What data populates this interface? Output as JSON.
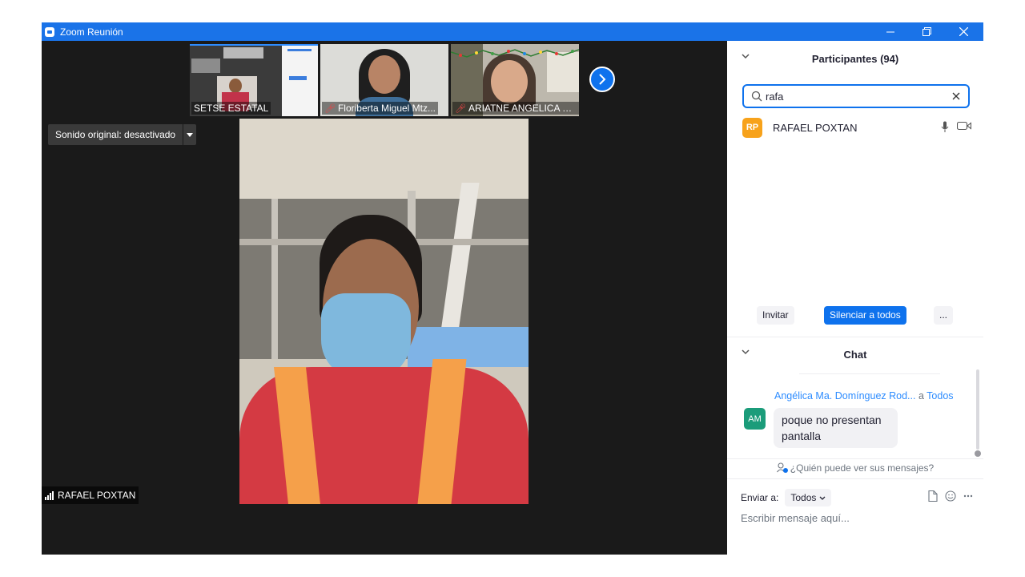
{
  "window": {
    "title": "Zoom Reunión",
    "controls": {
      "minimize": "—",
      "restore": "❐",
      "close": "✕"
    }
  },
  "gallery": {
    "thumbnails": [
      {
        "name": "SETSE ESTATAL",
        "muted": false
      },
      {
        "name": "Floriberta Miguel Mtz...",
        "muted": true
      },
      {
        "name": "ARIATNE ANGELICA R...",
        "muted": true
      }
    ],
    "next_icon": "chevron-right-icon"
  },
  "sound_button": {
    "label": "Sonido original: desactivado"
  },
  "active_speaker": {
    "name": "RAFAEL POXTAN"
  },
  "participants": {
    "header": "Participantes (94)",
    "search_value": "rafa",
    "list": [
      {
        "initials": "RP",
        "name": "RAFAEL POXTAN",
        "avatar_color": "#f7a21b"
      }
    ],
    "buttons": {
      "invite": "Invitar",
      "mute_all": "Silenciar a todos",
      "more": "..."
    }
  },
  "chat": {
    "header": "Chat",
    "messages": [
      {
        "initials": "AM",
        "avatar_color": "#1b9c7a",
        "sender": "Angélica Ma. Domínguez Rod...",
        "to_prefix": "a",
        "to": "Todos",
        "text": "poque no presentan pantalla"
      }
    ],
    "who_can_see": "¿Quién puede ver sus mensajes?",
    "send_to_label": "Enviar a:",
    "send_to_value": "Todos",
    "input_placeholder": "Escribir mensaje aquí..."
  },
  "colors": {
    "accent": "#0e72ed",
    "titlebar": "#1a73e8",
    "video_bg": "#1a1a1a"
  }
}
